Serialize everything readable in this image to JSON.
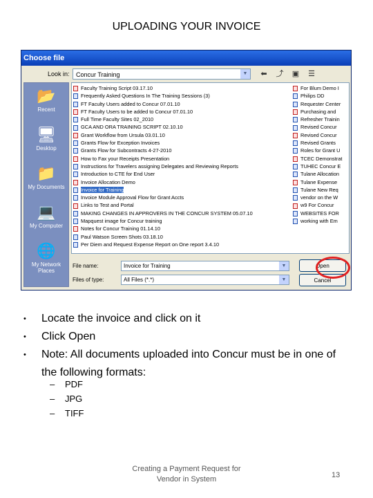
{
  "slide": {
    "title": "UPLOADING YOUR INVOICE",
    "footer_line1": "Creating a Payment Request for",
    "footer_line2": "Vendor in System",
    "page_number": "13"
  },
  "dialog": {
    "title": "Choose file",
    "look_in_label": "Look in:",
    "look_in_value": "Concur Training",
    "places": [
      {
        "label": "Recent",
        "icon": "recent-folder-icon"
      },
      {
        "label": "Desktop",
        "icon": "desktop-icon"
      },
      {
        "label": "My Documents",
        "icon": "my-documents-icon"
      },
      {
        "label": "My Computer",
        "icon": "my-computer-icon"
      },
      {
        "label": "My Network Places",
        "icon": "network-places-icon"
      }
    ],
    "files_col1": [
      "Faculty Training Script 03.17.10",
      "Frequently Asked Questions In The Training Sessions (3)",
      "FT Faculty Users added to Concur 07.01.10",
      "FT Faculty Users to be added to Concur 07.01.10",
      "Full Time Faculty Sites 02_2010",
      "GCA AND ORA TRAINING SCRIPT 02.10.10",
      "Grant Workflow from Ursula 03.01.10",
      "Grants Flow for Exception Invoices",
      "Grants Flow for Subcontracts 4-27-2010",
      "How to Fax your Receipts Presentation",
      "Instructions for Travelers assigning Delegates and Reviewing Reports",
      "Introduction to CTE for End User",
      "Invoice Allocation Demo",
      "Invoice for Training",
      "Invoice Module Approval Flow for Grant Accts",
      "Links to Test and Portal",
      "MAKING CHANGES IN APPROVERS IN THE CONCUR SYSTEM 05.07.10",
      "Mapquest image for Concur training",
      "Notes for Concur Training 01.14.10",
      "Paul Watson Screen Shots 03.18.10",
      "Per Diem and Request Expense Report on One report 3.4.10"
    ],
    "files_col2": [
      "For Blum Demo I",
      "Philips DD",
      "Requester Center",
      "Purchasing and",
      "Refresher Trainin",
      "Revised Concur",
      "Revised Concur",
      "Revised Grants",
      "Roles for Grant U",
      "TCEC Demonstrat",
      "TUHEC Concur E",
      "Tulane Allocation",
      "Tulane Expense",
      "Tulane New Req",
      "vendor on the W",
      "w9 For Concur",
      "WEBSITES FOR",
      "working with Em"
    ],
    "selected_file": "Invoice for Training",
    "file_name_label": "File name:",
    "file_name_value": "Invoice for Training",
    "file_type_label": "Files of type:",
    "file_type_value": "All Files (*.*)",
    "open_label": "Open",
    "cancel_label": "Cancel"
  },
  "bullets": [
    "Locate the  invoice and click on it",
    "Click Open",
    "Note: All documents uploaded into Concur must be in one of the following formats:"
  ],
  "formats": [
    "PDF",
    "JPG",
    "TIFF"
  ]
}
